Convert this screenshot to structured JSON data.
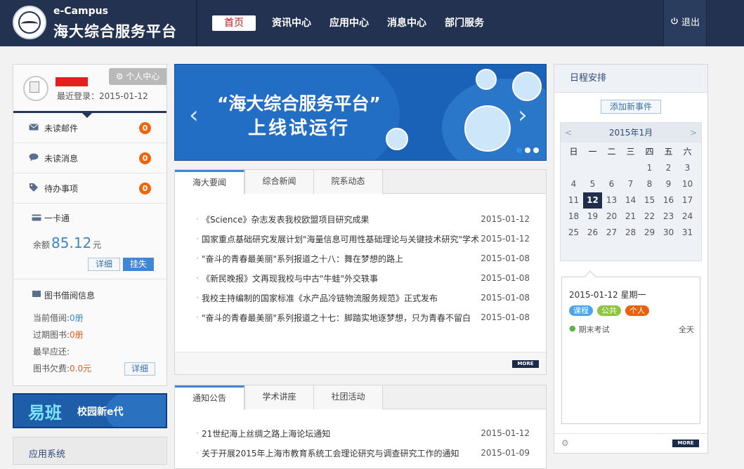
{
  "header": {
    "brand_en": "e-Campus",
    "brand_cn": "海大综合服务平台",
    "nav": [
      "首页",
      "资讯中心",
      "应用中心",
      "消息中心",
      "部门服务"
    ],
    "logout": "退出"
  },
  "user": {
    "last_login": "最近登录：2015-01-12",
    "personal_center": "个人中心",
    "rows": [
      {
        "label": "未读邮件",
        "count": "0",
        "icon": "mail-icon"
      },
      {
        "label": "未读消息",
        "count": "0",
        "icon": "chat-icon"
      },
      {
        "label": "待办事项",
        "count": "0",
        "icon": "tag-icon"
      }
    ],
    "card": {
      "title": "一卡通",
      "balance_label": "余额",
      "balance": "85.12",
      "unit": "元",
      "detail": "详细",
      "lost": "挂失"
    },
    "library": {
      "title": "图书借阅信息",
      "current_label": "当前借阅:",
      "current_value": "0册",
      "overdue_label": "过期图书:",
      "overdue_value": "0册",
      "earliest_label": "最早应还:",
      "fine_label": "图书欠费:",
      "fine_value": "0.0元",
      "detail": "详细"
    }
  },
  "yiban": {
    "brand": "易班",
    "slogan": "校园新e代"
  },
  "apps_title": "应用系统",
  "banner": {
    "line1": "“海大综合服务平台”",
    "line2": "上线试运行"
  },
  "news1": {
    "tabs": [
      "海大要闻",
      "综合新闻",
      "院系动态"
    ],
    "items": [
      {
        "title": "《Science》杂志发表我校欧盟项目研究成果",
        "date": "2015-01-12"
      },
      {
        "title": "国家重点基础研究发展计划\"海量信息可用性基础理论与关键技术研究\"学术",
        "date": "2015-01-12"
      },
      {
        "title": "\"奋斗的青春最美丽\"系列报道之十八：舞在梦想的路上",
        "date": "2015-01-08"
      },
      {
        "title": "《新民晚报》文再现我校与中古\"牛蛙\"外交轶事",
        "date": "2015-01-08"
      },
      {
        "title": "我校主持编制的国家标准《水产品冷链物流服务规范》正式发布",
        "date": "2015-01-08"
      },
      {
        "title": "\"奋斗的青春最美丽\"系列报道之十七：脚踏实地逐梦想，只为青春不留白",
        "date": "2015-01-08"
      }
    ],
    "more": "MORE"
  },
  "news2": {
    "tabs": [
      "通知公告",
      "学术讲座",
      "社团活动"
    ],
    "items": [
      {
        "title": "21世纪海上丝绸之路上海论坛通知",
        "date": "2015-01-12"
      },
      {
        "title": "关于开展2015年上海市教育系统工会理论研究与调查研究工作的通知",
        "date": "2015-01-09"
      }
    ]
  },
  "schedule": {
    "title": "日程安排",
    "add_event": "添加新事件",
    "month": "2015年1月",
    "prev": "<",
    "next": ">",
    "weekdays": [
      "日",
      "一",
      "二",
      "三",
      "四",
      "五",
      "六"
    ],
    "days": [
      "",
      "",
      "",
      "",
      "1",
      "2",
      "3",
      "4",
      "5",
      "6",
      "7",
      "8",
      "9",
      "10",
      "11",
      "12",
      "13",
      "14",
      "15",
      "16",
      "17",
      "18",
      "19",
      "20",
      "21",
      "22",
      "23",
      "24",
      "25",
      "26",
      "27",
      "28",
      "29",
      "30",
      "31"
    ],
    "today": "12",
    "selected_date": "2015-01-12 星期一",
    "tags": [
      {
        "label": "课程",
        "color": "#4fa3e8"
      },
      {
        "label": "公共",
        "color": "#8cc63f"
      },
      {
        "label": "个人",
        "color": "#e8620f"
      }
    ],
    "event": {
      "name": "期末考试",
      "time": "全天"
    },
    "more": "MORE"
  }
}
